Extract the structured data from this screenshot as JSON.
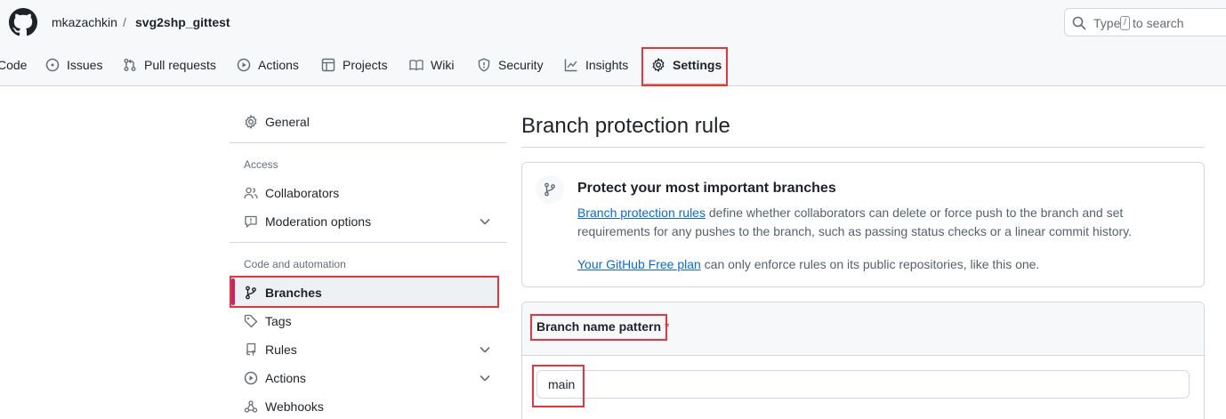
{
  "header": {
    "owner": "mkazachkin",
    "separator": "/",
    "repo": "svg2shp_gittest",
    "search": {
      "prefix": "Type",
      "key": "/",
      "suffix": "to search"
    }
  },
  "tabs": [
    {
      "label": "Code",
      "icon": "code-icon"
    },
    {
      "label": "Issues",
      "icon": "issue-opened-icon"
    },
    {
      "label": "Pull requests",
      "icon": "git-pull-request-icon"
    },
    {
      "label": "Actions",
      "icon": "play-icon"
    },
    {
      "label": "Projects",
      "icon": "table-icon"
    },
    {
      "label": "Wiki",
      "icon": "book-icon"
    },
    {
      "label": "Security",
      "icon": "shield-icon"
    },
    {
      "label": "Insights",
      "icon": "graph-icon"
    },
    {
      "label": "Settings",
      "icon": "gear-icon",
      "selected": true
    }
  ],
  "sidebar": {
    "general": "General",
    "access_heading": "Access",
    "collaborators": "Collaborators",
    "moderation": "Moderation options",
    "code_heading": "Code and automation",
    "branches": "Branches",
    "tags": "Tags",
    "rules": "Rules",
    "actions": "Actions",
    "webhooks": "Webhooks"
  },
  "main": {
    "title": "Branch protection rule",
    "info": {
      "title": "Protect your most important branches",
      "link1": "Branch protection rules",
      "line1_rest": " define whether collaborators can delete or force push to the branch and set",
      "line2": "requirements for any pushes to the branch, such as passing status checks or a linear commit history.",
      "link2": "Your GitHub Free plan",
      "line3_rest": " can only enforce rules on its public repositories, like this one."
    },
    "pattern": {
      "label": "Branch name pattern",
      "required_mark": "*",
      "value": "main"
    }
  },
  "colors": {
    "highlight": "#e5363d",
    "link": "#0969da",
    "active_marker": "#cf2261"
  }
}
